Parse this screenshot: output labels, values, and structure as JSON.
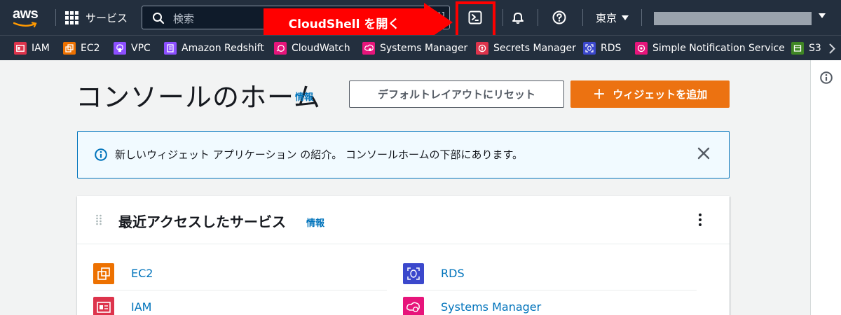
{
  "header": {
    "logo_text": "aws",
    "services_label": "サービス",
    "search_placeholder": "検索",
    "search_shortcut": "[Alt+S]",
    "region": "東京",
    "account": ""
  },
  "annotation": {
    "callout_text": "CloudShell を開く",
    "highlight_color": "#ff0000"
  },
  "favorites": [
    {
      "label": "IAM",
      "icon": "iam-icon",
      "color": "#dd344c"
    },
    {
      "label": "EC2",
      "icon": "ec2-icon",
      "color": "#ed7100"
    },
    {
      "label": "VPC",
      "icon": "vpc-icon",
      "color": "#8c4fff"
    },
    {
      "label": "Amazon Redshift",
      "icon": "redshift-icon",
      "color": "#8c4fff"
    },
    {
      "label": "CloudWatch",
      "icon": "cloudwatch-icon",
      "color": "#e7157b"
    },
    {
      "label": "Systems Manager",
      "icon": "systems-manager-icon",
      "color": "#e7157b"
    },
    {
      "label": "Secrets Manager",
      "icon": "secrets-manager-icon",
      "color": "#dd344c"
    },
    {
      "label": "RDS",
      "icon": "rds-icon",
      "color": "#3b48cc"
    },
    {
      "label": "Simple Notification Service",
      "icon": "sns-icon",
      "color": "#e7157b"
    },
    {
      "label": "S3",
      "icon": "s3-icon",
      "color": "#3f8624"
    }
  ],
  "page": {
    "title": "コンソールのホーム",
    "info_link": "情報",
    "reset_button": "デフォルトレイアウトにリセット",
    "add_widget_button": "ウィジェットを追加"
  },
  "alert": {
    "message": "新しいウィジェット アプリケーション の紹介。 コンソールホームの下部にあります。"
  },
  "recent": {
    "title": "最近アクセスしたサービス",
    "info_link": "情報",
    "items": [
      {
        "label": "EC2",
        "icon": "ec2-icon",
        "color": "#ed7100"
      },
      {
        "label": "RDS",
        "icon": "rds-icon",
        "color": "#3b48cc"
      },
      {
        "label": "IAM",
        "icon": "iam-icon",
        "color": "#dd344c"
      },
      {
        "label": "Systems Manager",
        "icon": "systems-manager-icon",
        "color": "#e7157b"
      }
    ]
  },
  "colors": {
    "nav_bg": "#232f3e",
    "primary_orange": "#ec7211",
    "link_blue": "#0073bb",
    "page_bg": "#f2f3f3"
  }
}
